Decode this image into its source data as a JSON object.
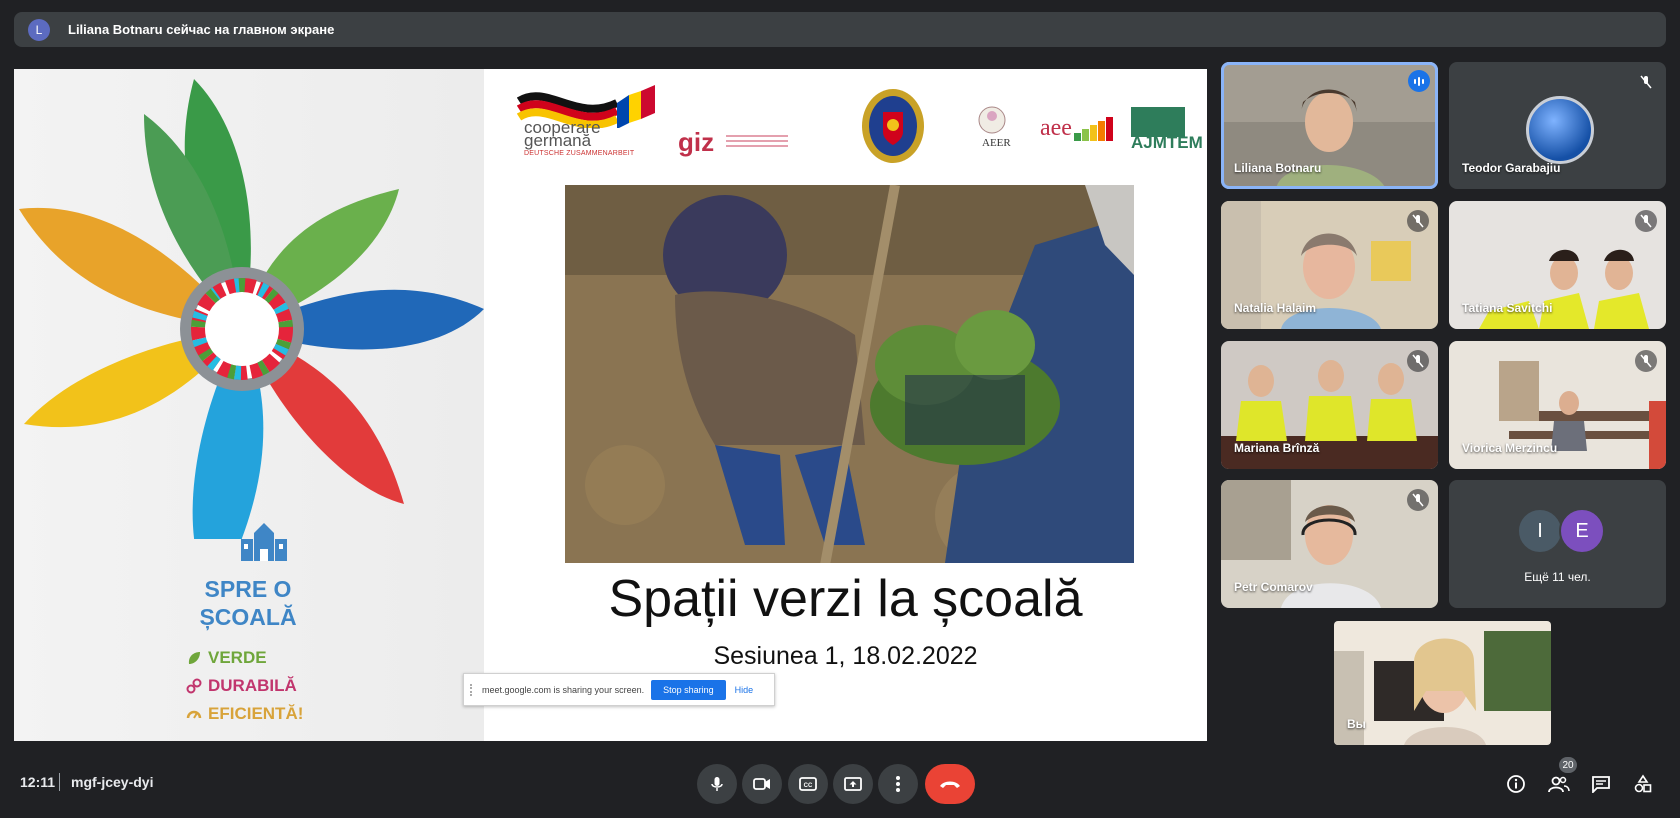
{
  "banner": {
    "avatar_letter": "L",
    "text": "Liliana Botnaru сейчас на главном экране"
  },
  "slide": {
    "spre_line1": "SPRE O",
    "spre_line2": "ȘCOALĂ",
    "slogan_verde": "VERDE",
    "slogan_durabila": "DURABILĂ",
    "slogan_eficienta": "EFICIENTĂ!",
    "coop_line1": "cooperare",
    "coop_line2": "germană",
    "coop_line3": "DEUTSCHE ZUSAMMENARBEIT",
    "giz": "giz",
    "aeer": "AEER",
    "aee": "aee",
    "ajmtem": "AJMTEM",
    "title": "Spații verzi la școală",
    "subtitle": "Sesiunea 1, 18.02.2022"
  },
  "share_bar": {
    "text": "meet.google.com is sharing your screen.",
    "stop": "Stop sharing",
    "hide": "Hide"
  },
  "participants": [
    {
      "name": "Liliana Botnaru",
      "speaking": true
    },
    {
      "name": "Teodor Garabajiu",
      "muted": true
    },
    {
      "name": "Natalia Halaim",
      "muted": true
    },
    {
      "name": "Tatiana Savitchi",
      "muted": true
    },
    {
      "name": "Mariana Brînză",
      "muted": true
    },
    {
      "name": "Viorica Merzincu",
      "muted": true
    },
    {
      "name": "Petr Comarov",
      "muted": true
    },
    {
      "name": "Вы"
    }
  ],
  "more": {
    "avatar1": "I",
    "avatar2": "E",
    "text": "Ещё 11 чел."
  },
  "bottom": {
    "time": "12:11",
    "meeting_code": "mgf-jcey-dyi",
    "people_count": "20"
  },
  "colors": {
    "background": "#202124",
    "tile": "#3c4043",
    "end_call": "#ea4335",
    "accent": "#1a73e8"
  }
}
